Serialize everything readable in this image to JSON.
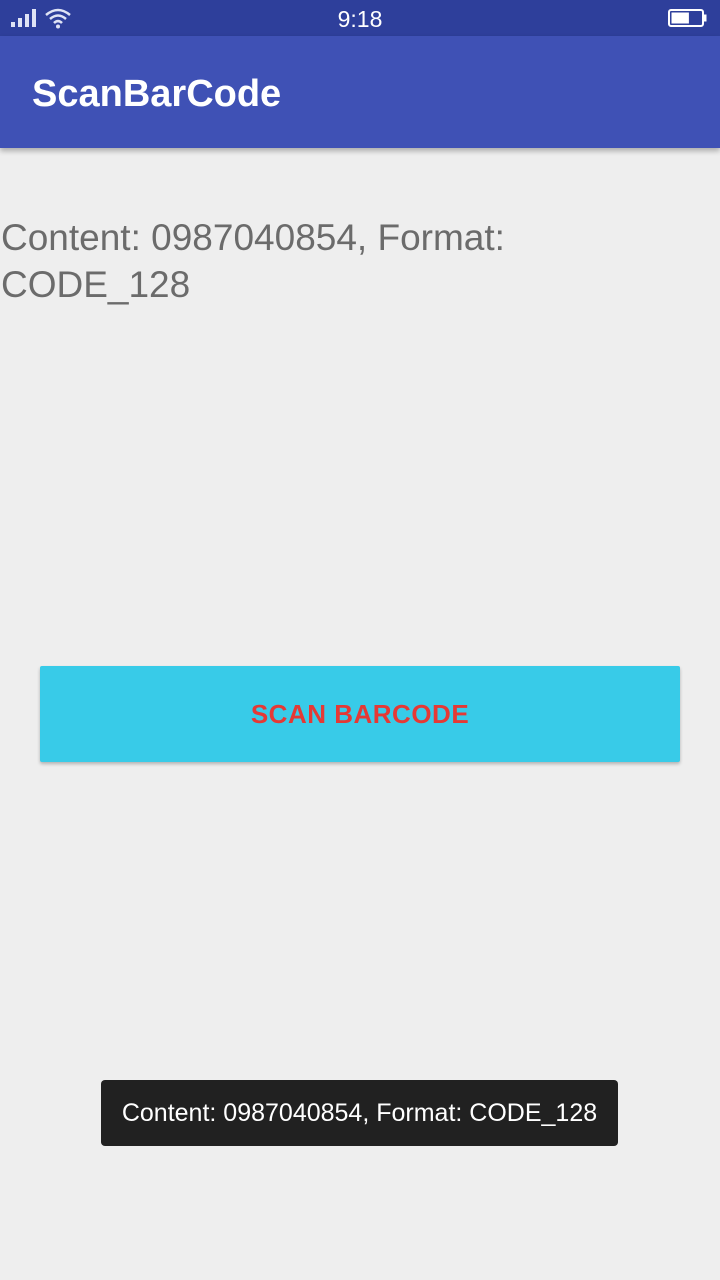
{
  "status_bar": {
    "time": "9:18",
    "icons": [
      "signal-icon",
      "wifi-icon",
      "battery-icon"
    ],
    "battery_level": 0.6
  },
  "app_bar": {
    "title": "ScanBarCode",
    "color": "#3f51b5"
  },
  "main": {
    "result_text": "Content: 0987040854, Format: CODE_128",
    "scan_button_label": "SCAN BARCODE",
    "scan_button_color": "#38cbe8",
    "scan_button_text_color": "#e53935"
  },
  "toast": {
    "message": "Content: 0987040854, Format: CODE_128"
  }
}
